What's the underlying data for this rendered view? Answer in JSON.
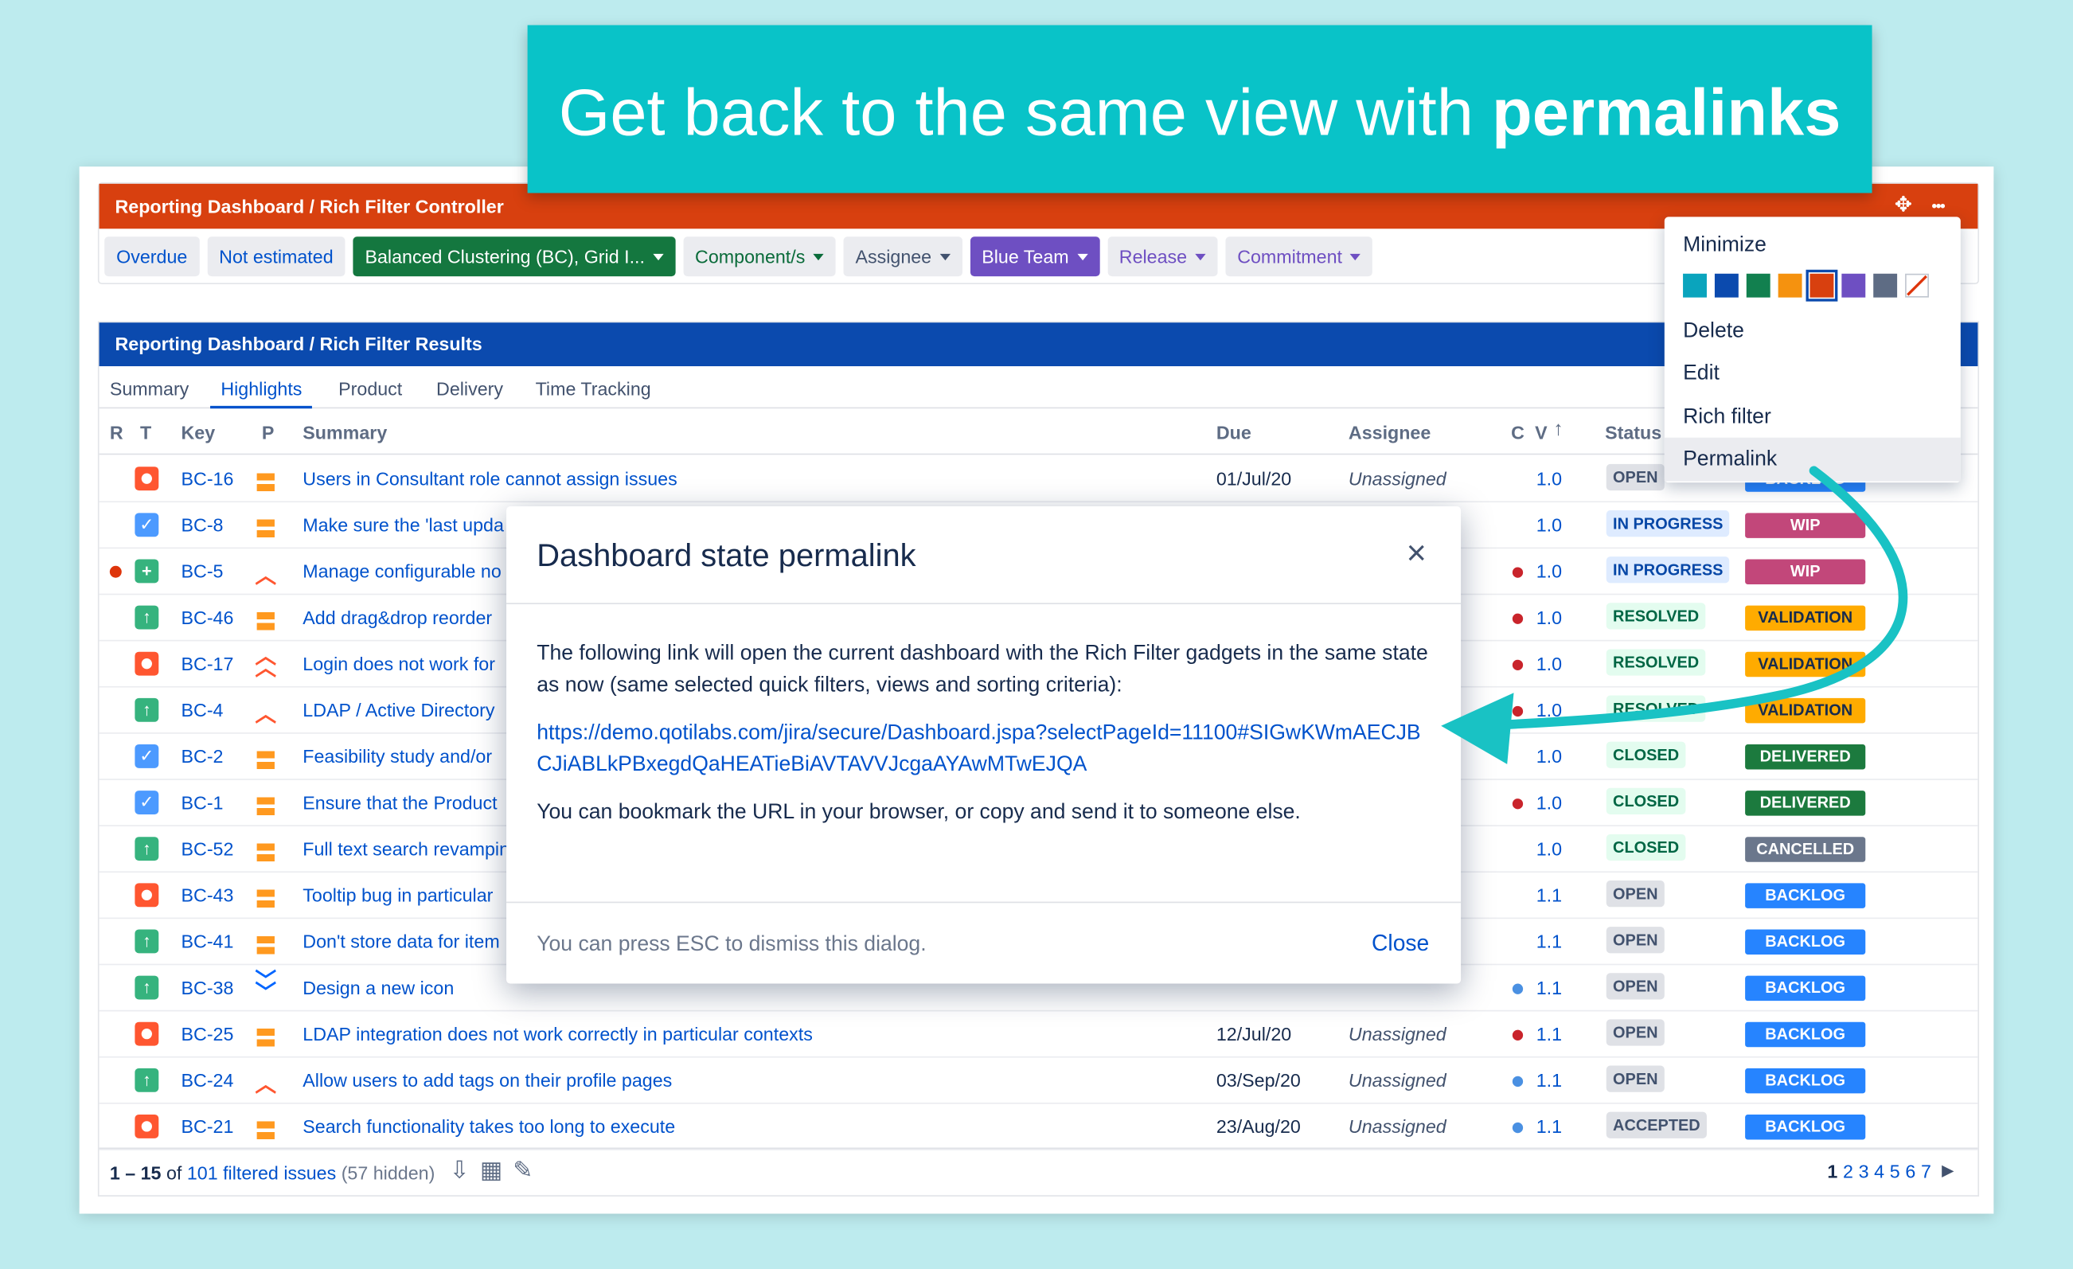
{
  "banner": {
    "text": "Get back to the same view with ",
    "bold": "permalinks"
  },
  "controller": {
    "title": "Reporting Dashboard / Rich Filter Controller",
    "move_icon": "✥",
    "more_icon": "•••",
    "quick_filters": [
      {
        "label": "Overdue"
      },
      {
        "label": "Not estimated"
      },
      {
        "label": "Balanced Clustering (BC), Grid I..."
      },
      {
        "label": "Component/s"
      },
      {
        "label": "Assignee"
      },
      {
        "label": "Blue Team"
      },
      {
        "label": "Release"
      },
      {
        "label": "Commitment"
      }
    ]
  },
  "results": {
    "title": "Reporting Dashboard / Rich Filter Results",
    "tabs": [
      "Summary",
      "Highlights",
      "Product",
      "Delivery",
      "Time Tracking"
    ],
    "active_tab": "Highlights",
    "columns": {
      "r": "R",
      "t": "T",
      "key": "Key",
      "p": "P",
      "summary": "Summary",
      "due": "Due",
      "assignee": "Assignee",
      "c": "C",
      "v": "V",
      "sort_icon": "↑",
      "status": "Status"
    },
    "rows": [
      {
        "r": false,
        "type": "bug",
        "key": "BC-16",
        "priority": "medium",
        "summary": "Users in Consultant role cannot assign issues",
        "due": "01/Jul/20",
        "assignee": "Unassigned",
        "c": "",
        "version": "1.0",
        "status": "OPEN",
        "status_class": "open",
        "label": "BACKLOG",
        "label_class": "backlog"
      },
      {
        "r": false,
        "type": "task",
        "key": "BC-8",
        "priority": "medium",
        "summary": "Make sure the 'last upda",
        "due": "",
        "assignee": "",
        "c": "",
        "version": "1.0",
        "status": "IN PROGRESS",
        "status_class": "inprog",
        "label": "WIP",
        "label_class": "wip"
      },
      {
        "r": true,
        "type": "new",
        "key": "BC-5",
        "priority": "high",
        "summary": "Manage configurable no",
        "due": "",
        "assignee": "",
        "c": "red",
        "version": "1.0",
        "status": "IN PROGRESS",
        "status_class": "inprog",
        "label": "WIP",
        "label_class": "wip"
      },
      {
        "r": false,
        "type": "story",
        "key": "BC-46",
        "priority": "medium",
        "summary": "Add drag&drop reorder",
        "due": "",
        "assignee": "",
        "c": "red",
        "version": "1.0",
        "status": "RESOLVED",
        "status_class": "done",
        "label": "VALIDATION",
        "label_class": "validation"
      },
      {
        "r": false,
        "type": "bug",
        "key": "BC-17",
        "priority": "highest",
        "summary": "Login does not work for",
        "due": "",
        "assignee": "",
        "c": "red",
        "version": "1.0",
        "status": "RESOLVED",
        "status_class": "done",
        "label": "VALIDATION",
        "label_class": "validation"
      },
      {
        "r": false,
        "type": "story",
        "key": "BC-4",
        "priority": "high",
        "summary": "LDAP / Active Directory",
        "due": "",
        "assignee": "",
        "c": "red",
        "version": "1.0",
        "status": "RESOLVED",
        "status_class": "done",
        "label": "VALIDATION",
        "label_class": "validation"
      },
      {
        "r": false,
        "type": "task",
        "key": "BC-2",
        "priority": "medium",
        "summary": "Feasibility study and/or",
        "due": "",
        "assignee": "",
        "c": "",
        "version": "1.0",
        "status": "CLOSED",
        "status_class": "done",
        "label": "DELIVERED",
        "label_class": "delivered"
      },
      {
        "r": false,
        "type": "task",
        "key": "BC-1",
        "priority": "medium",
        "summary": "Ensure that the Product",
        "due": "",
        "assignee": "",
        "c": "red",
        "version": "1.0",
        "status": "CLOSED",
        "status_class": "done",
        "label": "DELIVERED",
        "label_class": "delivered"
      },
      {
        "r": false,
        "type": "story",
        "key": "BC-52",
        "priority": "medium",
        "summary": "Full text search revampin",
        "due": "",
        "assignee": "",
        "c": "",
        "version": "1.0",
        "status": "CLOSED",
        "status_class": "done",
        "label": "CANCELLED",
        "label_class": "cancelled"
      },
      {
        "r": false,
        "type": "bug",
        "key": "BC-43",
        "priority": "medium",
        "summary": "Tooltip bug in particular",
        "due": "",
        "assignee": "",
        "c": "",
        "version": "1.1",
        "status": "OPEN",
        "status_class": "open",
        "label": "BACKLOG",
        "label_class": "backlog"
      },
      {
        "r": false,
        "type": "story",
        "key": "BC-41",
        "priority": "medium",
        "summary": "Don't store data for item",
        "due": "",
        "assignee": "",
        "c": "",
        "version": "1.1",
        "status": "OPEN",
        "status_class": "open",
        "label": "BACKLOG",
        "label_class": "backlog"
      },
      {
        "r": false,
        "type": "story",
        "key": "BC-38",
        "priority": "lowest",
        "summary": "Design a new icon",
        "due": "",
        "assignee": "",
        "c": "blue",
        "version": "1.1",
        "status": "OPEN",
        "status_class": "open",
        "label": "BACKLOG",
        "label_class": "backlog"
      },
      {
        "r": false,
        "type": "bug",
        "key": "BC-25",
        "priority": "medium",
        "summary": "LDAP integration does not work correctly in particular contexts",
        "due": "12/Jul/20",
        "assignee": "Unassigned",
        "c": "red",
        "version": "1.1",
        "status": "OPEN",
        "status_class": "open",
        "label": "BACKLOG",
        "label_class": "backlog"
      },
      {
        "r": false,
        "type": "story",
        "key": "BC-24",
        "priority": "high",
        "summary": "Allow users to add tags on their profile pages",
        "due": "03/Sep/20",
        "assignee": "Unassigned",
        "c": "blue",
        "version": "1.1",
        "status": "OPEN",
        "status_class": "open",
        "label": "BACKLOG",
        "label_class": "backlog"
      },
      {
        "r": false,
        "type": "bug",
        "key": "BC-21",
        "priority": "medium",
        "summary": "Search functionality takes too long to execute",
        "due": "23/Aug/20",
        "assignee": "Unassigned",
        "c": "blue",
        "version": "1.1",
        "status": "ACCEPTED",
        "status_class": "accepted",
        "label": "BACKLOG",
        "label_class": "backlog"
      }
    ],
    "footer": {
      "range": "1 – 15",
      "of": " of ",
      "count": "101 filtered issues",
      "hidden": " (57 hidden)",
      "pages": [
        "1",
        "2",
        "3",
        "4",
        "5",
        "6",
        "7"
      ],
      "current_page": "1",
      "next_icon": "▶"
    }
  },
  "menu": {
    "items": [
      "Minimize",
      "Delete",
      "Edit",
      "Rich filter",
      "Permalink"
    ],
    "highlighted": "Permalink",
    "swatches": [
      "#0aa4bd",
      "#0b4aae",
      "#12804f",
      "#f5920f",
      "#d8400f",
      "#6e4fc2",
      "#5e6c84",
      "none"
    ],
    "selected_swatch": "#d8400f"
  },
  "dialog": {
    "title": "Dashboard state permalink",
    "close_icon": "×",
    "intro": "The following link will open the current dashboard with the Rich Filter gadgets in the same state as now (same selected quick filters, views and sorting criteria):",
    "url": "https://demo.qotilabs.com/jira/secure/Dashboard.jspa?selectPageId=11100#SIGwKWmAECJBCJiABLkPBxegdQaHEATieBiAVTAVVJcgaAYAwMTwEJQA",
    "note": "You can bookmark the URL in your browser, or copy and send it to someone else.",
    "esc_hint": "You can press ESC to dismiss this dialog.",
    "close_label": "Close"
  },
  "colors": {
    "banner": "#09c3c8",
    "controller_header": "#d8400f",
    "results_header": "#0b4aae",
    "arrow": "#19c2c4"
  }
}
